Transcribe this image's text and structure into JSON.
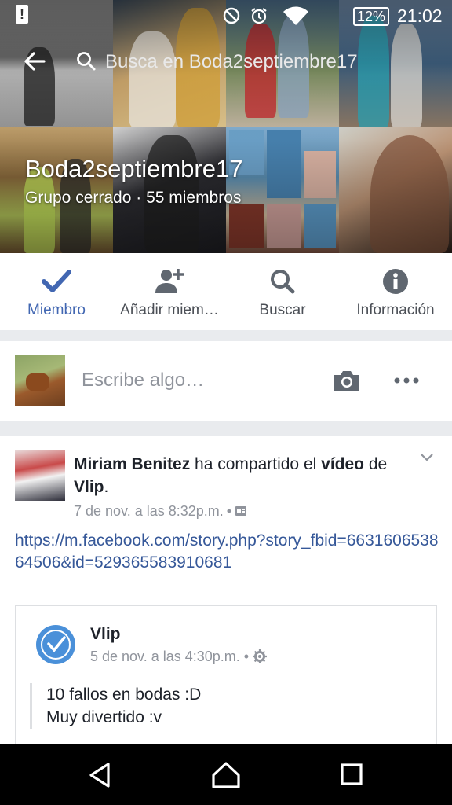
{
  "status_bar": {
    "battery_percent": "12%",
    "time": "21:02",
    "icons": [
      "battery-warning-icon",
      "do-not-disturb-icon",
      "alarm-icon",
      "wifi-icon",
      "battery-icon"
    ]
  },
  "search": {
    "placeholder": "Busca en Boda2septiembre17"
  },
  "group": {
    "name": "Boda2septiembre17",
    "meta": "Grupo cerrado · 55 miembros"
  },
  "actions": [
    {
      "label": "Miembro",
      "icon": "check-icon",
      "active": true
    },
    {
      "label": "Añadir miem…",
      "icon": "add-member-icon",
      "active": false
    },
    {
      "label": "Buscar",
      "icon": "search-icon",
      "active": false
    },
    {
      "label": "Información",
      "icon": "info-icon",
      "active": false
    }
  ],
  "composer": {
    "placeholder": "Escribe algo…"
  },
  "post": {
    "author": "Miriam Benitez",
    "action_text": " ha compartido el ",
    "object": "vídeo",
    "of_text": " de ",
    "page": "Vlip",
    "period": ".",
    "time": "7 de nov. a las 8:32p.m.",
    "link": "https://m.facebook.com/story.php?story_fbid=663160653864506&id=529365583910681",
    "shared": {
      "name": "Vlip",
      "time": "5 de nov. a las 4:30p.m.",
      "lines": [
        "10 fallos en bodas :D",
        "Muy divertido :v"
      ]
    }
  },
  "colors": {
    "accent": "#4267b2",
    "icon_gray": "#606770",
    "link": "#365899"
  }
}
